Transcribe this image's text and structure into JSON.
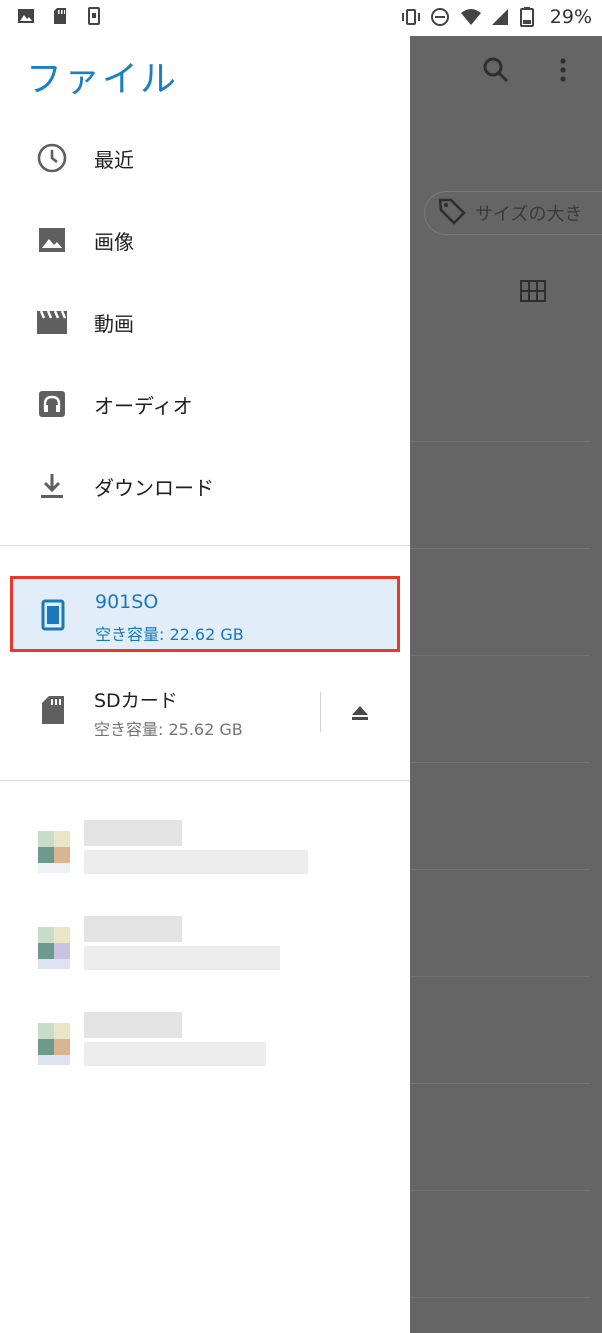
{
  "status_bar": {
    "battery": "29%",
    "left_icons": [
      "image-notification-icon",
      "sd-card-notification-icon",
      "phone-notification-icon"
    ],
    "right_icons": [
      "vibrate-icon",
      "do-not-disturb-icon",
      "wifi-icon",
      "signal-icon",
      "battery-icon"
    ]
  },
  "drawer": {
    "title": "ファイル",
    "nav_items": [
      {
        "label": "最近",
        "icon": "clock-icon"
      },
      {
        "label": "画像",
        "icon": "image-icon"
      },
      {
        "label": "動画",
        "icon": "movie-icon"
      },
      {
        "label": "オーディオ",
        "icon": "headphones-icon"
      },
      {
        "label": "ダウンロード",
        "icon": "download-icon"
      }
    ],
    "storage": [
      {
        "name": "901SO",
        "free": "空き容量: 22.62 GB",
        "icon": "phone-icon",
        "selected": true
      },
      {
        "name": "SDカード",
        "free": "空き容量: 25.62 GB",
        "icon": "sd-card-icon",
        "selected": false
      }
    ]
  },
  "background": {
    "chip_label": "サイズの大き"
  },
  "colors": {
    "accent": "#1b7fc6",
    "highlight_border": "#e8392a",
    "selected_bg": "#e1eef9",
    "scrim": "#656565"
  }
}
